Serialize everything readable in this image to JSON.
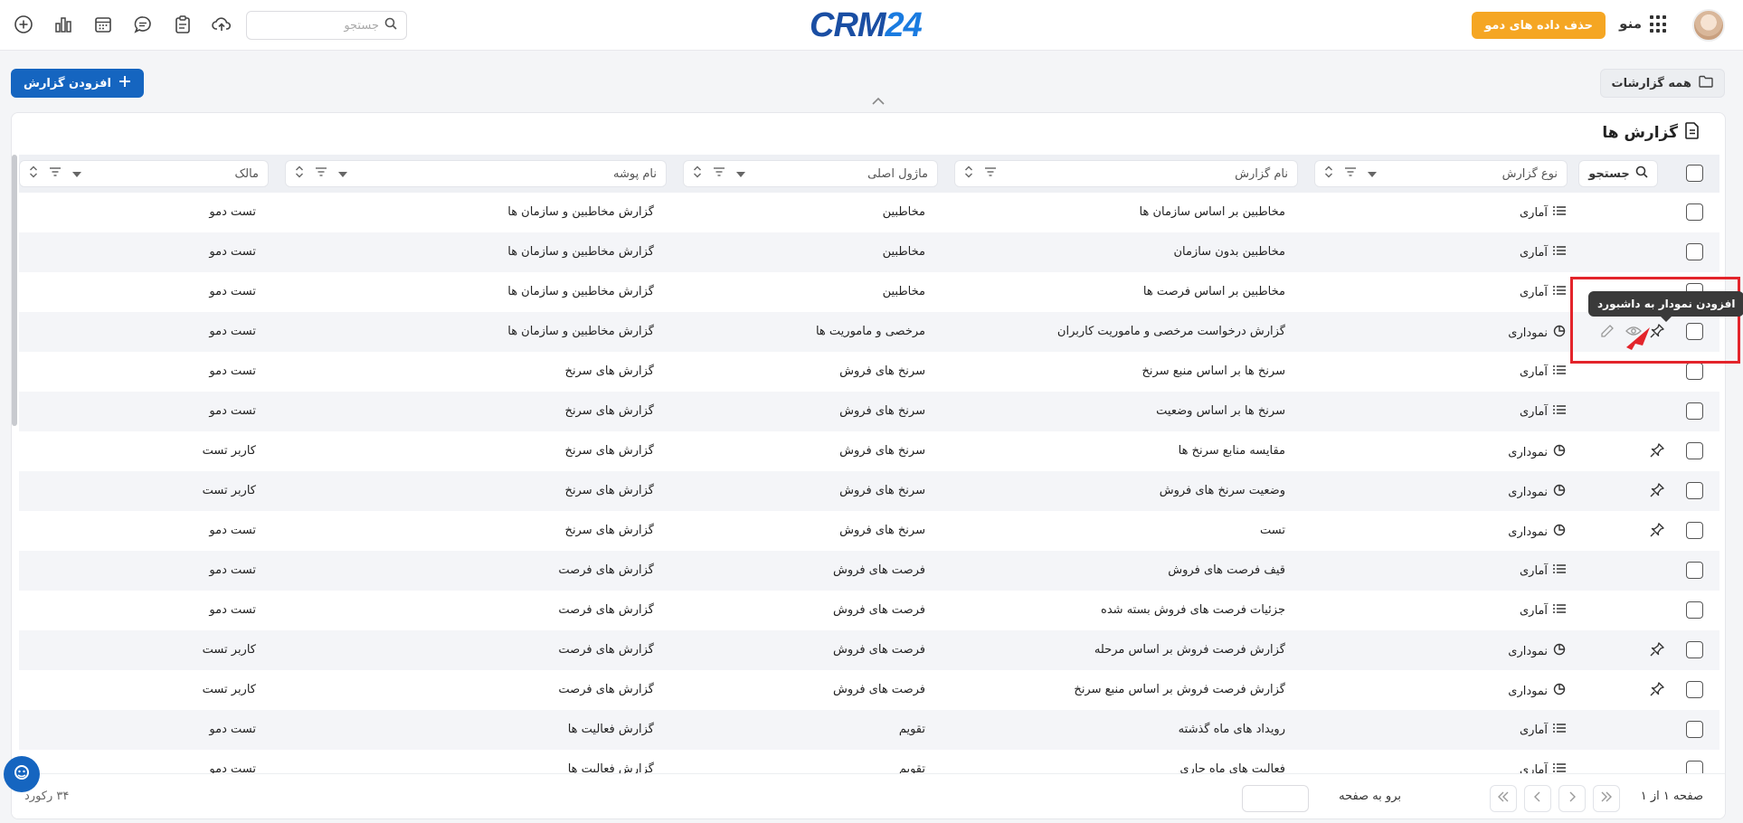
{
  "topbar": {
    "menu_label": "منو",
    "demo_button": "حذف داده های دمو",
    "logo_crm": "CRM",
    "logo_num": "24",
    "search_placeholder": "جستجو"
  },
  "actions": {
    "all_reports": "همه گزارشات",
    "add_report": "افزودن گزارش"
  },
  "card": {
    "title": "گزارش ها",
    "search_label": "جستجو",
    "columns": {
      "type": "نوع گزارش",
      "name": "نام گزارش",
      "module": "ماژول اصلی",
      "folder": "نام پوشه",
      "owner": "مالک"
    }
  },
  "rows": [
    {
      "type": "آماری",
      "kind": "stat",
      "pinned": false,
      "name": "مخاطبین بر اساس سازمان ها",
      "module": "مخاطبین",
      "folder": "گزارش مخاطبین و سازمان ها",
      "owner": "تست دمو"
    },
    {
      "type": "آماری",
      "kind": "stat",
      "pinned": false,
      "name": "مخاطبین بدون سازمان",
      "module": "مخاطبین",
      "folder": "گزارش مخاطبین و سازمان ها",
      "owner": "تست دمو"
    },
    {
      "type": "آماری",
      "kind": "stat",
      "pinned": false,
      "name": "مخاطبین بر اساس فرصت ها",
      "module": "مخاطبین",
      "folder": "گزارش مخاطبین و سازمان ها",
      "owner": "تست دمو"
    },
    {
      "type": "نموداری",
      "kind": "chart",
      "pinned": true,
      "hover": true,
      "name": "گزارش درخواست مرخصی و ماموریت کاربران",
      "module": "مرخصی و ماموریت ها",
      "folder": "گزارش مخاطبین و سازمان ها",
      "owner": "تست دمو"
    },
    {
      "type": "آماری",
      "kind": "stat",
      "pinned": false,
      "name": "سرنخ ها بر اساس منبع سرنخ",
      "module": "سرنخ های فروش",
      "folder": "گزارش های سرنخ",
      "owner": "تست دمو"
    },
    {
      "type": "آماری",
      "kind": "stat",
      "pinned": false,
      "name": "سرنخ ها بر اساس وضعیت",
      "module": "سرنخ های فروش",
      "folder": "گزارش های سرنخ",
      "owner": "تست دمو"
    },
    {
      "type": "نموداری",
      "kind": "chart",
      "pinned": true,
      "name": "مقایسه منابع سرنخ ها",
      "module": "سرنخ های فروش",
      "folder": "گزارش های سرنخ",
      "owner": "کاربر تست"
    },
    {
      "type": "نموداری",
      "kind": "chart",
      "pinned": true,
      "name": "وضعیت سرنخ های فروش",
      "module": "سرنخ های فروش",
      "folder": "گزارش های سرنخ",
      "owner": "کاربر تست"
    },
    {
      "type": "نموداری",
      "kind": "chart",
      "pinned": true,
      "name": "تست",
      "module": "سرنخ های فروش",
      "folder": "گزارش های سرنخ",
      "owner": "تست دمو"
    },
    {
      "type": "آماری",
      "kind": "stat",
      "pinned": false,
      "name": "قیف فرصت های فروش",
      "module": "فرصت های فروش",
      "folder": "گزارش های فرصت",
      "owner": "تست دمو"
    },
    {
      "type": "آماری",
      "kind": "stat",
      "pinned": false,
      "name": "جزئیات فرصت های فروش بسته شده",
      "module": "فرصت های فروش",
      "folder": "گزارش های فرصت",
      "owner": "تست دمو"
    },
    {
      "type": "نموداری",
      "kind": "chart",
      "pinned": true,
      "name": "گزارش فرصت فروش بر اساس مرحله",
      "module": "فرصت های فروش",
      "folder": "گزارش های فرصت",
      "owner": "کاربر تست"
    },
    {
      "type": "نموداری",
      "kind": "chart",
      "pinned": true,
      "name": "گزارش فرصت فروش بر اساس منبع سرنخ",
      "module": "فرصت های فروش",
      "folder": "گزارش های فرصت",
      "owner": "کاربر تست"
    },
    {
      "type": "آماری",
      "kind": "stat",
      "pinned": false,
      "name": "رویداد های ماه گذشته",
      "module": "تقویم",
      "folder": "گزارش فعالیت ها",
      "owner": "تست دمو"
    },
    {
      "type": "آماری",
      "kind": "stat",
      "pinned": false,
      "name": "فعالیت های ماه جاری",
      "module": "تقویم",
      "folder": "گزارش فعالیت ها",
      "owner": "تست دمو"
    }
  ],
  "tooltip": "افزودن نمودار به داشبورد",
  "footer": {
    "page_info": "صفحه ۱ از ۱",
    "goto_label": "برو به صفحه",
    "record_count": "۳۴ رکورد"
  },
  "colors": {
    "primary": "#1565c0",
    "demo_button": "#f5a623",
    "highlight": "#e3242b",
    "tooltip_bg": "#3a3a3a"
  }
}
